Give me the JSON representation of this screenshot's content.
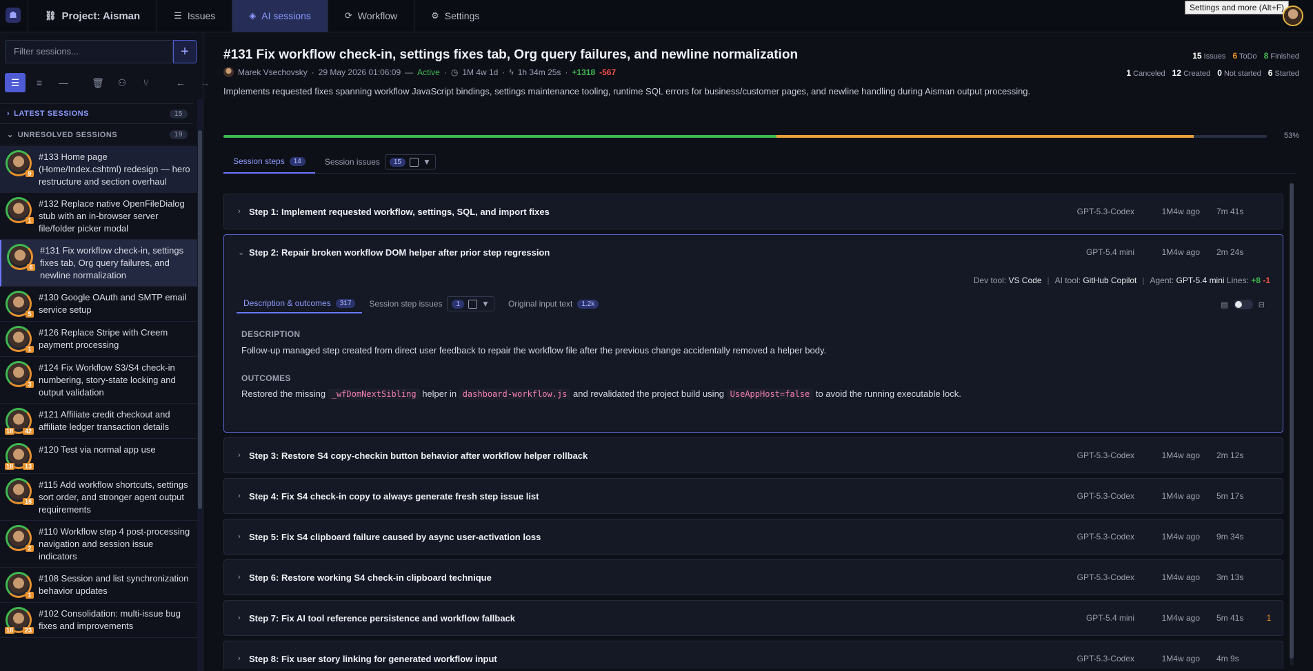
{
  "topbar": {
    "project": "Project: Aisman",
    "nav": [
      {
        "label": "Issues",
        "icon": "issues-icon"
      },
      {
        "label": "AI sessions",
        "icon": "layers-icon"
      },
      {
        "label": "Workflow",
        "icon": "workflow-icon"
      },
      {
        "label": "Settings",
        "icon": "gear-icon"
      }
    ],
    "tooltip": "Settings and more (Alt+F)"
  },
  "sidebar": {
    "filter_placeholder": "Filter sessions...",
    "add_label": "+",
    "sections": [
      {
        "label": "LATEST SESSIONS",
        "count": "15"
      },
      {
        "label": "UNRESOLVED SESSIONS",
        "count": "19"
      }
    ],
    "sessions": [
      {
        "title": "#133 Home page (Home/Index.cshtml) redesign — hero restructure and section overhaul",
        "badge": "9",
        "state": "hl"
      },
      {
        "title": "#132 Replace native OpenFileDialog stub with an in-browser server file/folder picker modal",
        "badge": "1",
        "state": ""
      },
      {
        "title": "#131 Fix workflow check-in, settings fixes tab, Org query failures, and newline normalization",
        "badge": "6",
        "state": "sel"
      },
      {
        "title": "#130 Google OAuth and SMTP email service setup",
        "badge": "5",
        "state": ""
      },
      {
        "title": "#126 Replace Stripe with Creem payment processing",
        "badge": "1",
        "state": ""
      },
      {
        "title": "#124 Fix Workflow S3/S4 check-in numbering, story-state locking and output validation",
        "badge": "3",
        "state": ""
      },
      {
        "title": "#121 Affiliate credit checkout and affiliate ledger transaction details",
        "badge": "42",
        "badge2": "18",
        "state": ""
      },
      {
        "title": "#120 Test via normal app use",
        "badge": "13",
        "badge2": "18",
        "state": ""
      },
      {
        "title": "#115 Add workflow shortcuts, settings sort order, and stronger agent output requirements",
        "badge": "18",
        "state": ""
      },
      {
        "title": "#110 Workflow step 4 post-processing navigation and session issue indicators",
        "badge": "2",
        "state": ""
      },
      {
        "title": "#108 Session and list synchronization behavior updates",
        "badge": "1",
        "state": ""
      },
      {
        "title": "#102 Consolidation: multi-issue bug fixes and improvements",
        "badge": "23",
        "badge2": "18",
        "state": ""
      }
    ]
  },
  "session": {
    "title": "#131 Fix workflow check-in, settings fixes tab, Org query failures, and newline normalization",
    "author": "Marek Vsechovsky",
    "date": "29 May 2026 01:06:09",
    "status": "Active",
    "age": "1M 4w 1d",
    "duration": "1h 34m 25s",
    "added": "+1318",
    "removed": "-567",
    "description": "Implements requested fixes spanning workflow JavaScript bindings, settings maintenance tooling, runtime SQL errors for business/customer pages, and newline handling during Aisman output processing.",
    "stats": {
      "issues": "15",
      "issues_l": "Issues",
      "todo": "6",
      "todo_l": "ToDo",
      "finished": "8",
      "finished_l": "Finished",
      "canceled": "1",
      "canceled_l": "Canceled",
      "created": "12",
      "created_l": "Created",
      "notstarted": "0",
      "notstarted_l": "Not started",
      "started": "6",
      "started_l": "Started"
    },
    "progress": {
      "done": 0.53,
      "in_progress": 0.4,
      "label": "53%"
    },
    "tabs": {
      "steps": "Session steps",
      "steps_count": "14",
      "issues": "Session issues",
      "issues_count": "15"
    }
  },
  "steps": [
    {
      "title": "Step 1: Implement requested workflow, settings, SQL, and import fixes",
      "model": "GPT-5.3-Codex",
      "ago": "1M4w ago",
      "dur": "7m 41s",
      "extra": ""
    },
    {
      "title": "Step 2: Repair broken workflow DOM helper after prior step regression",
      "model": "GPT-5.4 mini",
      "ago": "1M4w ago",
      "dur": "2m 24s",
      "extra": ""
    },
    {
      "title": "Step 3: Restore S4 copy-checkin button behavior after workflow helper rollback",
      "model": "GPT-5.3-Codex",
      "ago": "1M4w ago",
      "dur": "2m 12s",
      "extra": ""
    },
    {
      "title": "Step 4: Fix S4 check-in copy to always generate fresh step issue list",
      "model": "GPT-5.3-Codex",
      "ago": "1M4w ago",
      "dur": "5m 17s",
      "extra": ""
    },
    {
      "title": "Step 5: Fix S4 clipboard failure caused by async user-activation loss",
      "model": "GPT-5.3-Codex",
      "ago": "1M4w ago",
      "dur": "9m 34s",
      "extra": ""
    },
    {
      "title": "Step 6: Restore working S4 check-in clipboard technique",
      "model": "GPT-5.3-Codex",
      "ago": "1M4w ago",
      "dur": "3m 13s",
      "extra": ""
    },
    {
      "title": "Step 7: Fix AI tool reference persistence and workflow fallback",
      "model": "GPT-5.4 mini",
      "ago": "1M4w ago",
      "dur": "5m 41s",
      "extra": "1"
    },
    {
      "title": "Step 8: Fix user story linking for generated workflow input",
      "model": "GPT-5.3-Codex",
      "ago": "1M4w ago",
      "dur": "4m 9s",
      "extra": ""
    }
  ],
  "expanded": {
    "devtool_l": "Dev tool:",
    "devtool": "VS Code",
    "aitool_l": "AI tool:",
    "aitool": "GitHub Copilot",
    "agent_l": "Agent:",
    "agent": "GPT-5.4 mini",
    "lines_l": "Lines:",
    "lines_add": "+8",
    "lines_rem": "-1",
    "tab_desc": "Description & outcomes",
    "tab_desc_count": "317",
    "tab_issues": "Session step issues",
    "tab_issues_count": "1",
    "tab_input": "Original input text",
    "tab_input_count": "1.2k",
    "desc_label": "DESCRIPTION",
    "desc": "Follow-up managed step created from direct user feedback to repair the workflow file after the previous change accidentally removed a helper body.",
    "out_label": "OUTCOMES",
    "out_1": "Restored the missing",
    "code_1": "_wfDomNextSibling",
    "out_2": "helper in",
    "code_2": "dashboard-workflow.js",
    "out_3": "and revalidated the project build using",
    "code_3": "UseAppHost=false",
    "out_4": "to avoid the running executable lock."
  }
}
